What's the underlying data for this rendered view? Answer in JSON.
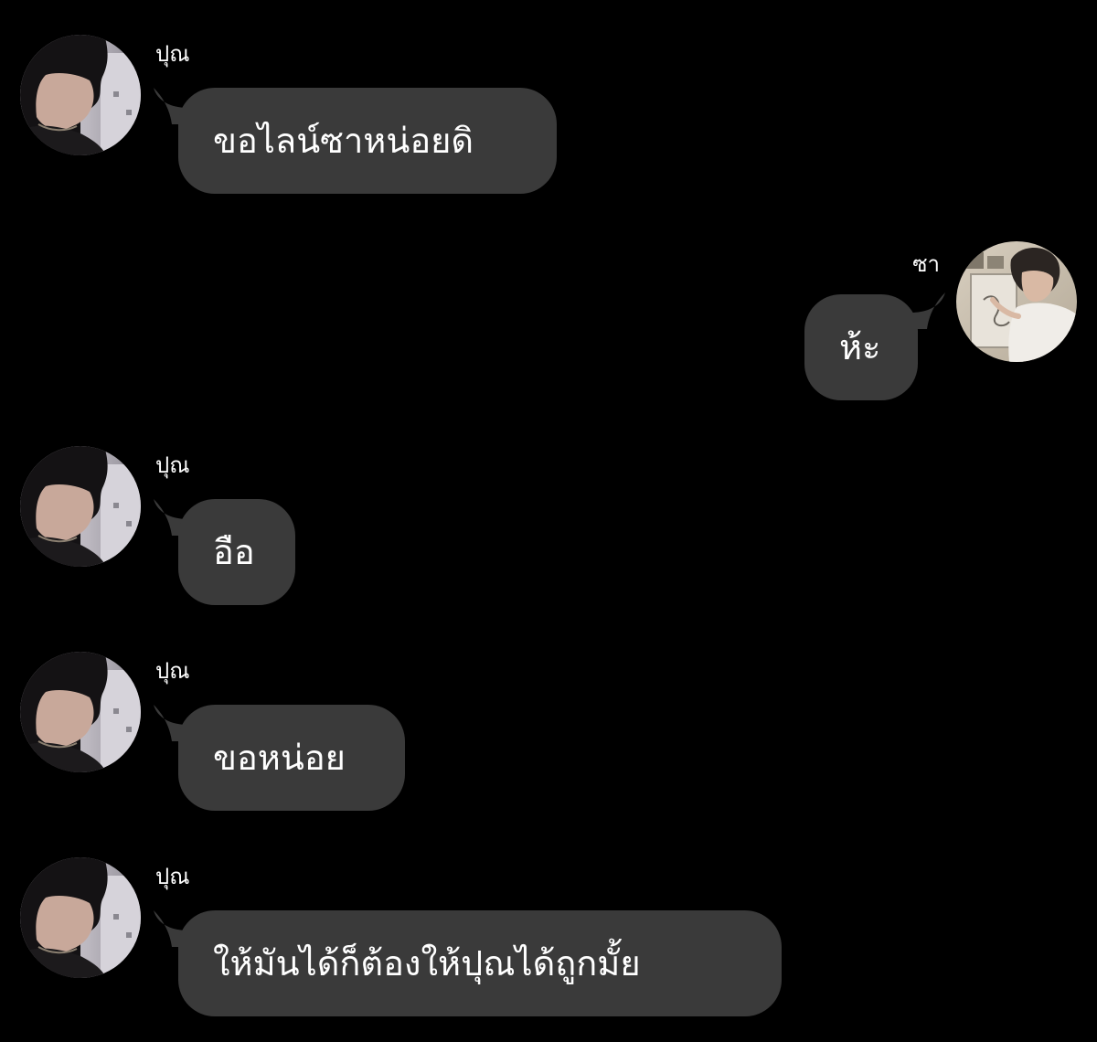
{
  "theme": {
    "background": "#000000",
    "bubble_color": "#3a3a3a",
    "text_color": "#ffffff"
  },
  "messages": [
    {
      "sender": "ปุณ",
      "text": "ขอไลน์ซาหน่อยดิ",
      "side": "left",
      "avatar_icon": "profile-photo-pun"
    },
    {
      "sender": "ซา",
      "text": "ห้ะ",
      "side": "right",
      "avatar_icon": "profile-photo-sa"
    },
    {
      "sender": "ปุณ",
      "text": "อือ",
      "side": "left",
      "avatar_icon": "profile-photo-pun"
    },
    {
      "sender": "ปุณ",
      "text": "ขอหน่อย",
      "side": "left",
      "avatar_icon": "profile-photo-pun"
    },
    {
      "sender": "ปุณ",
      "text": "ให้มันได้ก็ต้องให้ปุณได้ถูกมั้ย",
      "side": "left",
      "avatar_icon": "profile-photo-pun"
    }
  ]
}
